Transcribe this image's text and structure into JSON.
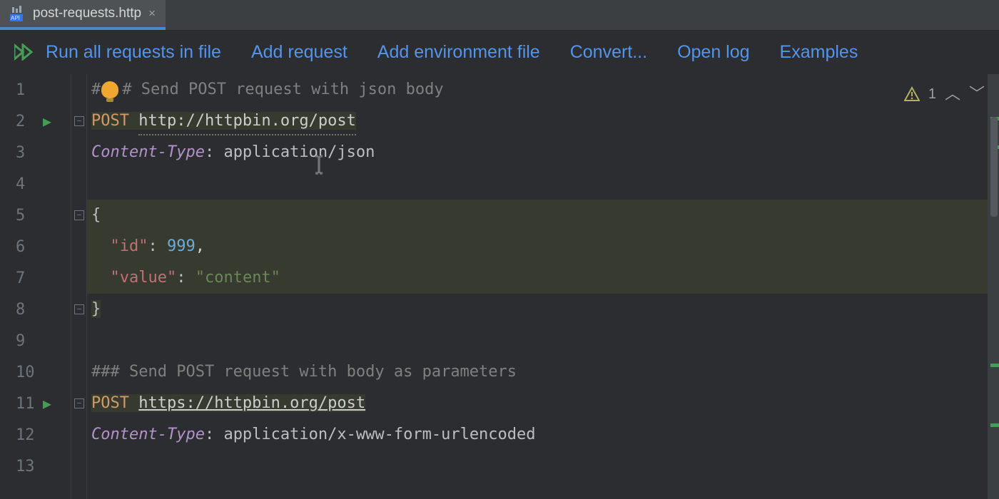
{
  "tab": {
    "filename": "post-requests.http"
  },
  "toolbar": {
    "run_all": "Run all requests in file",
    "add_request": "Add request",
    "add_env": "Add environment file",
    "convert": "Convert...",
    "open_log": "Open log",
    "examples": "Examples"
  },
  "inspection": {
    "count": "1"
  },
  "lines": [
    "1",
    "2",
    "3",
    "4",
    "5",
    "6",
    "7",
    "8",
    "9",
    "10",
    "11",
    "12",
    "13"
  ],
  "code": {
    "l1_prefix": "#",
    "l1_rest": "# Send POST request with json body",
    "l2_method": "POST ",
    "l2_url": "http://httpbin.org/post",
    "l3_header": "Content-Type",
    "l3_value": ": application/json",
    "l5": "{",
    "l6_key": "\"id\"",
    "l6_colon": ": ",
    "l6_val": "999",
    "l6_comma": ",",
    "l7_key": "\"value\"",
    "l7_colon": ": ",
    "l7_val": "\"content\"",
    "l8": "}",
    "l10": "### Send POST request with body as parameters",
    "l11_method": "POST ",
    "l11_url": "https://httpbin.org/post",
    "l12_header": "Content-Type",
    "l12_value": ": application/x-www-form-urlencoded"
  }
}
